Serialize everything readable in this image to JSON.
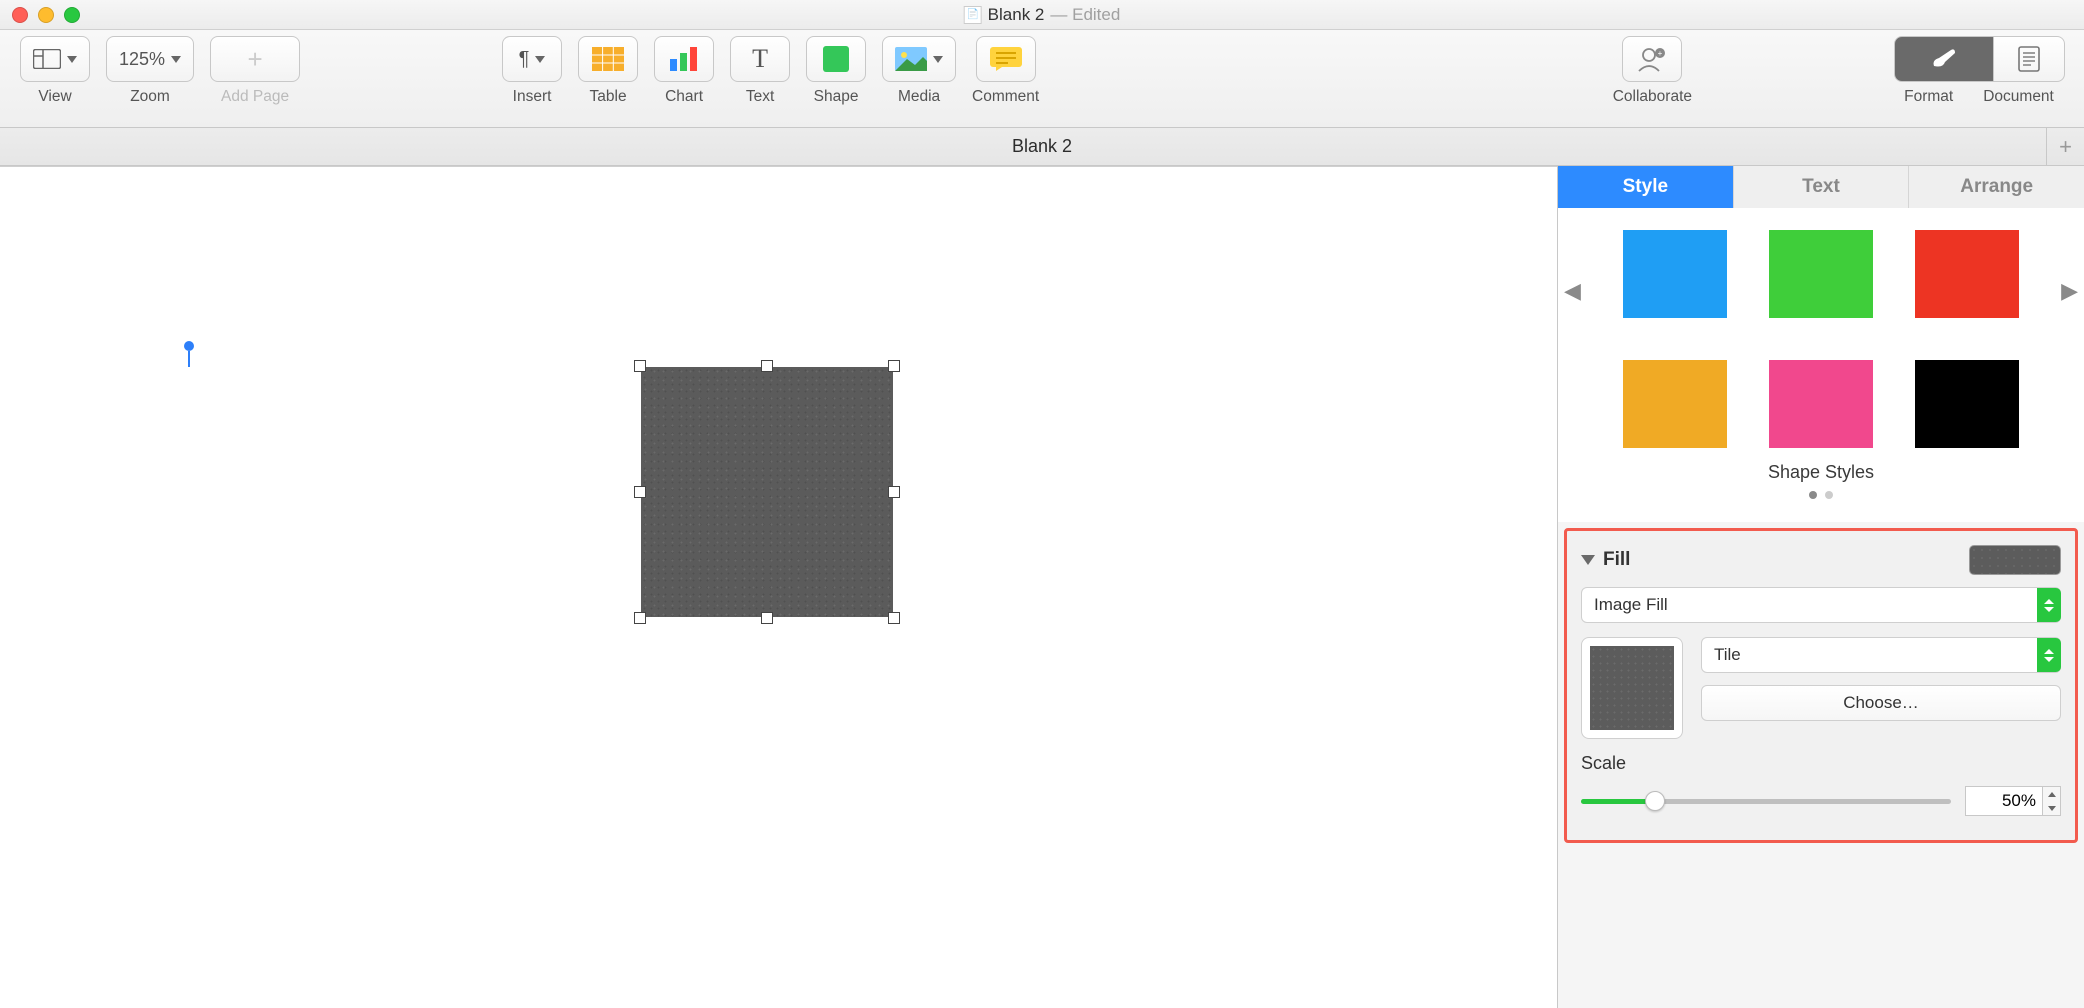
{
  "title": {
    "doc": "Blank 2",
    "suffix": "— Edited",
    "tab": "Blank 2"
  },
  "toolbar": {
    "view": "View",
    "zoom_value": "125%",
    "zoom": "Zoom",
    "add_page": "Add Page",
    "insert": "Insert",
    "table": "Table",
    "chart": "Chart",
    "text": "Text",
    "shape": "Shape",
    "media": "Media",
    "comment": "Comment",
    "collaborate": "Collaborate",
    "format": "Format",
    "document": "Document"
  },
  "inspector": {
    "tabs": {
      "style": "Style",
      "text": "Text",
      "arrange": "Arrange"
    },
    "shape_styles_label": "Shape Styles",
    "swatches": [
      "#1f9ef4",
      "#3fce3a",
      "#ed3423",
      "#f0aa25",
      "#f1488d",
      "#000000"
    ],
    "fill": {
      "heading": "Fill",
      "type": "Image Fill",
      "tiling": "Tile",
      "choose": "Choose…",
      "scale_label": "Scale",
      "scale_value": "50%",
      "scale_pct": 20
    }
  }
}
